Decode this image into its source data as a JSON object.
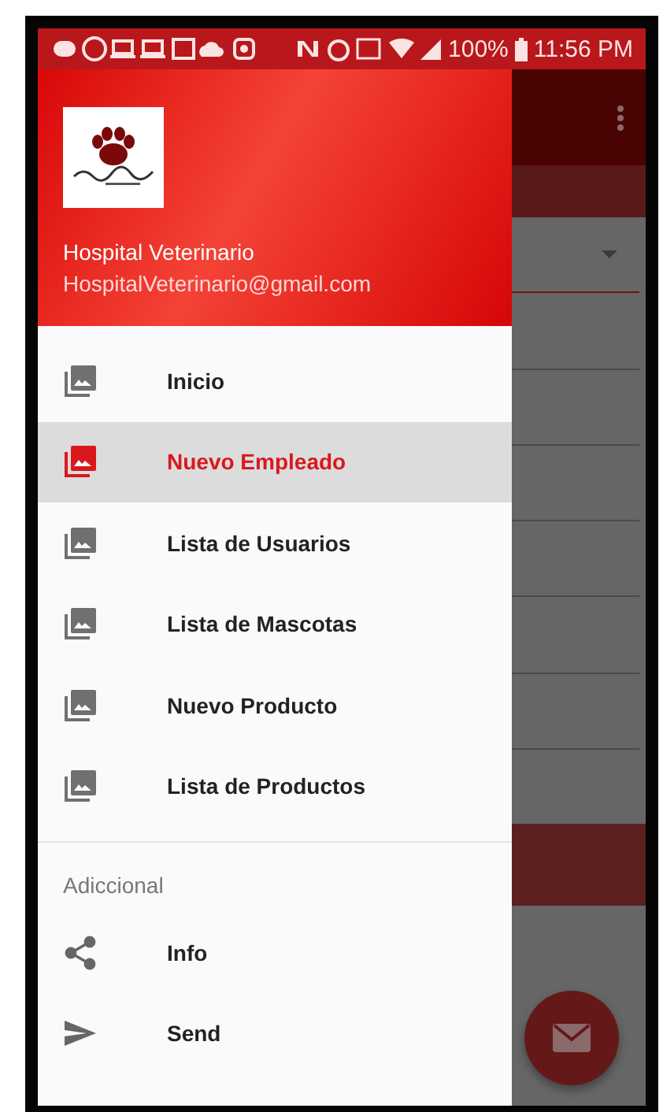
{
  "status_bar": {
    "battery": "100%",
    "time": "11:56 PM"
  },
  "drawer": {
    "header": {
      "title": "Hospital Veterinario",
      "email": "HospitalVeterinario@gmail.com"
    },
    "items": [
      {
        "label": "Inicio",
        "selected": false
      },
      {
        "label": "Nuevo Empleado",
        "selected": true
      },
      {
        "label": "Lista de Usuarios",
        "selected": false
      },
      {
        "label": "Lista de Mascotas",
        "selected": false
      },
      {
        "label": "Nuevo Producto",
        "selected": false
      },
      {
        "label": "Lista de Productos",
        "selected": false
      }
    ],
    "section": {
      "title": "Adiccional",
      "items": [
        {
          "label": "Info",
          "kind": "share"
        },
        {
          "label": "Send",
          "kind": "send"
        }
      ]
    }
  }
}
